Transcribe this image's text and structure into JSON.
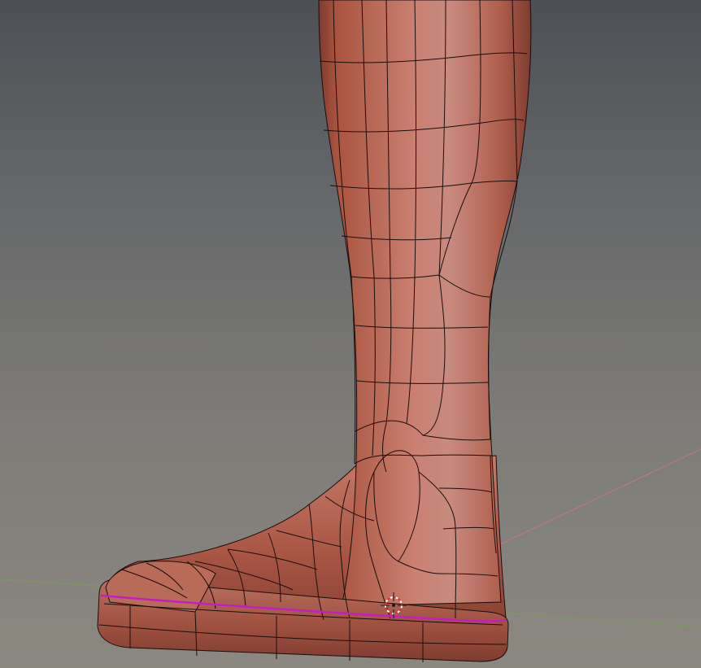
{
  "viewport": {
    "shading": "solid",
    "object": "leg-with-shoe",
    "mode": "edit-mesh-wireframe-overlay"
  },
  "colors": {
    "background_top": "#4c4f54",
    "background_bottom": "#8b8880",
    "mesh_light": "#c88070",
    "mesh_mid": "#b0604e",
    "mesh_dark": "#7e3c30",
    "wire": "#1a0d0a",
    "selected_edge": "#c21fc2",
    "axis_x": "#c07884",
    "axis_y": "#7c9a5c",
    "cursor_red": "#e23030",
    "cursor_white": "#ffffff"
  },
  "icons": {
    "cursor": "3d-cursor-icon"
  }
}
